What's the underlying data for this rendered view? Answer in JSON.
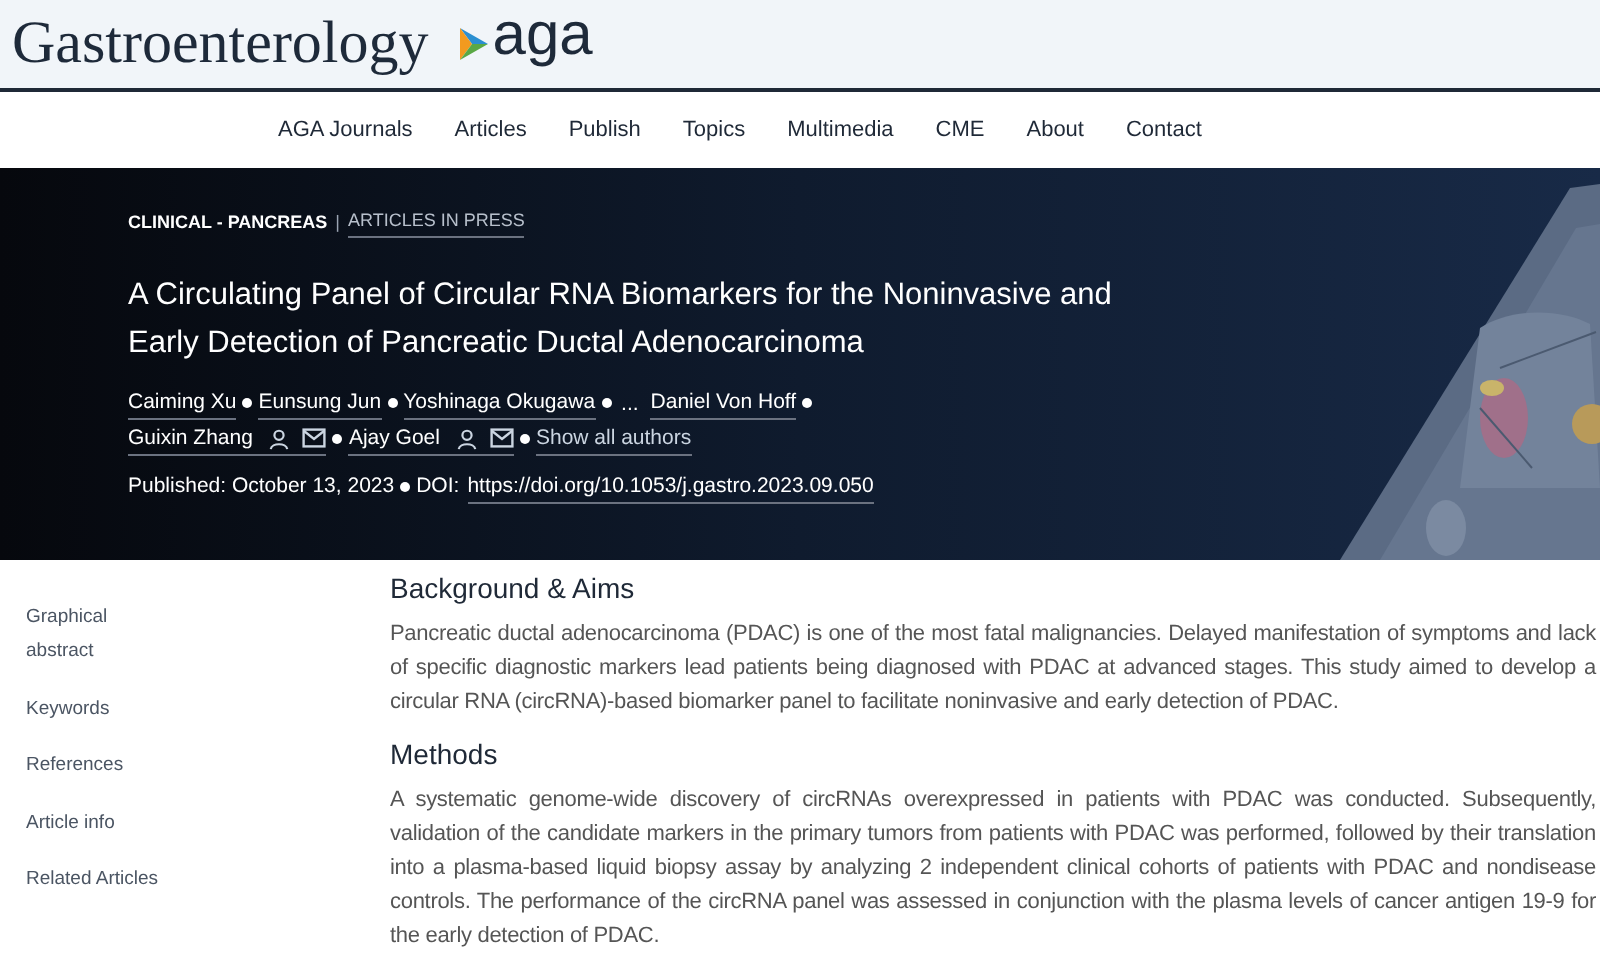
{
  "header": {
    "journal": "Gastroenterology",
    "society": "aga"
  },
  "nav": [
    "AGA Journals",
    "Articles",
    "Publish",
    "Topics",
    "Multimedia",
    "CME",
    "About",
    "Contact"
  ],
  "hero": {
    "section": "CLINICAL - PANCREAS",
    "separator": "|",
    "section_link": "ARTICLES IN PRESS",
    "title": "A Circulating Panel of Circular RNA Biomarkers for the Noninvasive and Early Detection of Pancreatic Ductal Adenocarcinoma",
    "authors": [
      {
        "kind": "author",
        "name": "Caiming Xu",
        "contact": false
      },
      {
        "kind": "author",
        "name": "Eunsung Jun",
        "contact": false
      },
      {
        "kind": "author",
        "name": "Yoshinaga Okugawa",
        "contact": false
      },
      {
        "kind": "gap",
        "name": "..."
      },
      {
        "kind": "author",
        "name": "Daniel Von Hoff",
        "contact": false
      },
      {
        "kind": "author",
        "name": "Guixin Zhang",
        "contact": true
      },
      {
        "kind": "author",
        "name": "Ajay Goel",
        "contact": true
      }
    ],
    "show_all": "Show all authors",
    "published": "Published: October 13, 2023",
    "doi_label": "DOI:",
    "doi": "https://doi.org/10.1053/j.gastro.2023.09.050"
  },
  "sidebar": [
    "Graphical abstract",
    "Keywords",
    "References",
    "Article info",
    "Related Articles"
  ],
  "sections": [
    {
      "heading": "Background & Aims",
      "text": "Pancreatic ductal adenocarcinoma (PDAC) is one of the most fatal malignancies. Delayed manifestation of symptoms and lack of specific diagnostic markers lead patients being diagnosed with PDAC at advanced stages. This study aimed to develop a circular RNA (circRNA)-based biomarker panel to facilitate noninvasive and early detection of PDAC."
    },
    {
      "heading": "Methods",
      "text": "A systematic genome-wide discovery of circRNAs overexpressed in patients with PDAC was conducted. Subsequently, validation of the candidate markers in the primary tumors from patients with PDAC was performed, followed by their translation into a plasma-based liquid biopsy assay by analyzing 2 independent clinical cohorts of patients with PDAC and nondisease controls. The performance of the circRNA panel was assessed in conjunction with the plasma levels of cancer antigen 19-9 for the early detection of PDAC."
    }
  ]
}
